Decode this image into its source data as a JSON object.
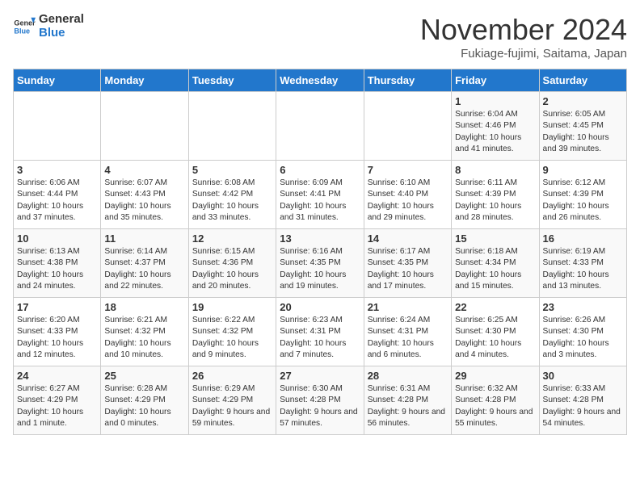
{
  "header": {
    "logo_general": "General",
    "logo_blue": "Blue",
    "month_year": "November 2024",
    "location": "Fukiage-fujimi, Saitama, Japan"
  },
  "days_of_week": [
    "Sunday",
    "Monday",
    "Tuesday",
    "Wednesday",
    "Thursday",
    "Friday",
    "Saturday"
  ],
  "weeks": [
    [
      {
        "day": "",
        "info": ""
      },
      {
        "day": "",
        "info": ""
      },
      {
        "day": "",
        "info": ""
      },
      {
        "day": "",
        "info": ""
      },
      {
        "day": "",
        "info": ""
      },
      {
        "day": "1",
        "info": "Sunrise: 6:04 AM\nSunset: 4:46 PM\nDaylight: 10 hours and 41 minutes."
      },
      {
        "day": "2",
        "info": "Sunrise: 6:05 AM\nSunset: 4:45 PM\nDaylight: 10 hours and 39 minutes."
      }
    ],
    [
      {
        "day": "3",
        "info": "Sunrise: 6:06 AM\nSunset: 4:44 PM\nDaylight: 10 hours and 37 minutes."
      },
      {
        "day": "4",
        "info": "Sunrise: 6:07 AM\nSunset: 4:43 PM\nDaylight: 10 hours and 35 minutes."
      },
      {
        "day": "5",
        "info": "Sunrise: 6:08 AM\nSunset: 4:42 PM\nDaylight: 10 hours and 33 minutes."
      },
      {
        "day": "6",
        "info": "Sunrise: 6:09 AM\nSunset: 4:41 PM\nDaylight: 10 hours and 31 minutes."
      },
      {
        "day": "7",
        "info": "Sunrise: 6:10 AM\nSunset: 4:40 PM\nDaylight: 10 hours and 29 minutes."
      },
      {
        "day": "8",
        "info": "Sunrise: 6:11 AM\nSunset: 4:39 PM\nDaylight: 10 hours and 28 minutes."
      },
      {
        "day": "9",
        "info": "Sunrise: 6:12 AM\nSunset: 4:39 PM\nDaylight: 10 hours and 26 minutes."
      }
    ],
    [
      {
        "day": "10",
        "info": "Sunrise: 6:13 AM\nSunset: 4:38 PM\nDaylight: 10 hours and 24 minutes."
      },
      {
        "day": "11",
        "info": "Sunrise: 6:14 AM\nSunset: 4:37 PM\nDaylight: 10 hours and 22 minutes."
      },
      {
        "day": "12",
        "info": "Sunrise: 6:15 AM\nSunset: 4:36 PM\nDaylight: 10 hours and 20 minutes."
      },
      {
        "day": "13",
        "info": "Sunrise: 6:16 AM\nSunset: 4:35 PM\nDaylight: 10 hours and 19 minutes."
      },
      {
        "day": "14",
        "info": "Sunrise: 6:17 AM\nSunset: 4:35 PM\nDaylight: 10 hours and 17 minutes."
      },
      {
        "day": "15",
        "info": "Sunrise: 6:18 AM\nSunset: 4:34 PM\nDaylight: 10 hours and 15 minutes."
      },
      {
        "day": "16",
        "info": "Sunrise: 6:19 AM\nSunset: 4:33 PM\nDaylight: 10 hours and 13 minutes."
      }
    ],
    [
      {
        "day": "17",
        "info": "Sunrise: 6:20 AM\nSunset: 4:33 PM\nDaylight: 10 hours and 12 minutes."
      },
      {
        "day": "18",
        "info": "Sunrise: 6:21 AM\nSunset: 4:32 PM\nDaylight: 10 hours and 10 minutes."
      },
      {
        "day": "19",
        "info": "Sunrise: 6:22 AM\nSunset: 4:32 PM\nDaylight: 10 hours and 9 minutes."
      },
      {
        "day": "20",
        "info": "Sunrise: 6:23 AM\nSunset: 4:31 PM\nDaylight: 10 hours and 7 minutes."
      },
      {
        "day": "21",
        "info": "Sunrise: 6:24 AM\nSunset: 4:31 PM\nDaylight: 10 hours and 6 minutes."
      },
      {
        "day": "22",
        "info": "Sunrise: 6:25 AM\nSunset: 4:30 PM\nDaylight: 10 hours and 4 minutes."
      },
      {
        "day": "23",
        "info": "Sunrise: 6:26 AM\nSunset: 4:30 PM\nDaylight: 10 hours and 3 minutes."
      }
    ],
    [
      {
        "day": "24",
        "info": "Sunrise: 6:27 AM\nSunset: 4:29 PM\nDaylight: 10 hours and 1 minute."
      },
      {
        "day": "25",
        "info": "Sunrise: 6:28 AM\nSunset: 4:29 PM\nDaylight: 10 hours and 0 minutes."
      },
      {
        "day": "26",
        "info": "Sunrise: 6:29 AM\nSunset: 4:29 PM\nDaylight: 9 hours and 59 minutes."
      },
      {
        "day": "27",
        "info": "Sunrise: 6:30 AM\nSunset: 4:28 PM\nDaylight: 9 hours and 57 minutes."
      },
      {
        "day": "28",
        "info": "Sunrise: 6:31 AM\nSunset: 4:28 PM\nDaylight: 9 hours and 56 minutes."
      },
      {
        "day": "29",
        "info": "Sunrise: 6:32 AM\nSunset: 4:28 PM\nDaylight: 9 hours and 55 minutes."
      },
      {
        "day": "30",
        "info": "Sunrise: 6:33 AM\nSunset: 4:28 PM\nDaylight: 9 hours and 54 minutes."
      }
    ]
  ]
}
